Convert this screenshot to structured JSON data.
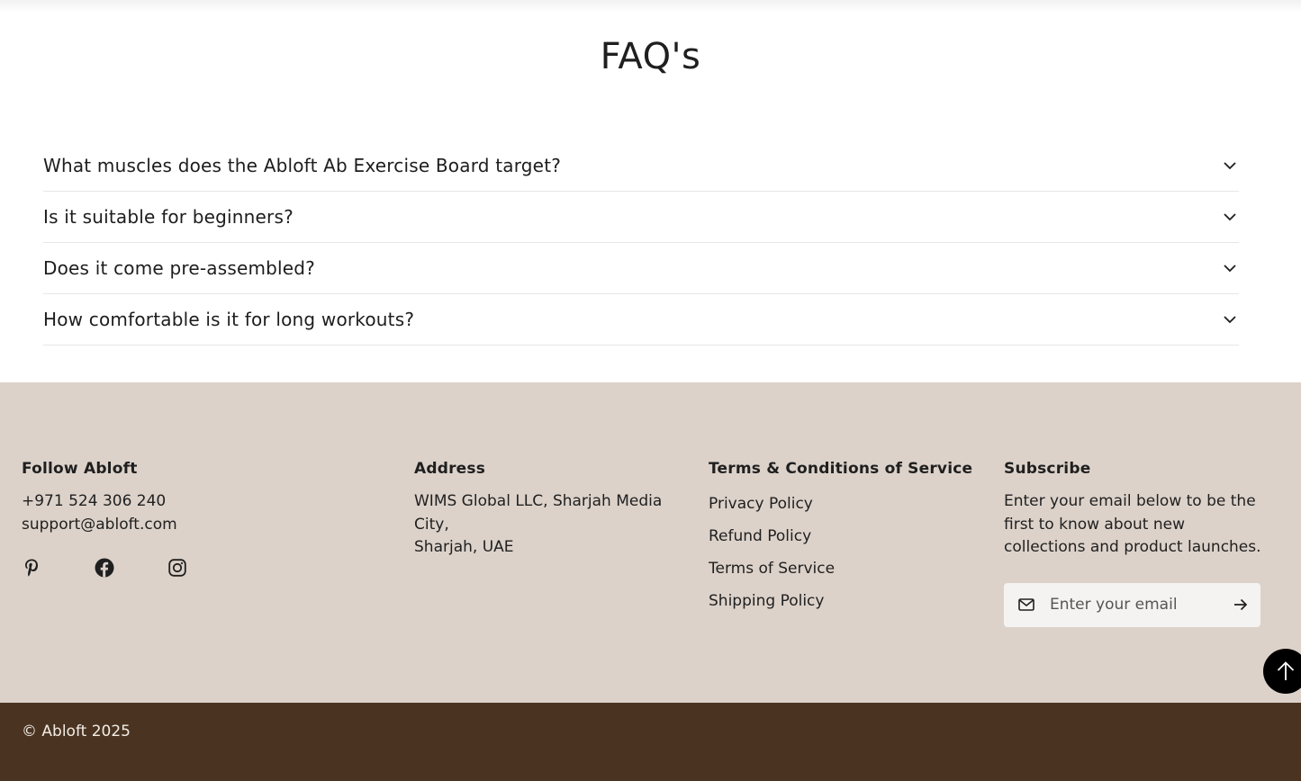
{
  "faq": {
    "title": "FAQ's",
    "items": [
      {
        "question": "What muscles does the Abloft Ab Exercise Board target?"
      },
      {
        "question": "Is it suitable for beginners?"
      },
      {
        "question": "Does it come pre-assembled?"
      },
      {
        "question": "How comfortable is it for long workouts?"
      }
    ]
  },
  "footer": {
    "follow": {
      "heading": "Follow Abloft",
      "phone": "+971 524 306 240",
      "email": "support@abloft.com",
      "social": [
        "pinterest-icon",
        "facebook-icon",
        "instagram-icon"
      ]
    },
    "address": {
      "heading": "Address",
      "line1": "WIMS Global LLC, Sharjah Media City,",
      "line2": "Sharjah, UAE"
    },
    "terms": {
      "heading": "Terms & Conditions of Service",
      "links": [
        "Privacy Policy",
        "Refund Policy",
        "Terms of Service",
        "Shipping Policy"
      ]
    },
    "subscribe": {
      "heading": "Subscribe",
      "text": "Enter your email below to be the first to know about new collections and product launches.",
      "placeholder": "Enter your email"
    }
  },
  "copyright": "© Abloft 2025",
  "colors": {
    "footer_bg": "#dcd2ca",
    "bottom_bar_bg": "#4a3421",
    "scroll_button_bg": "#000000"
  }
}
